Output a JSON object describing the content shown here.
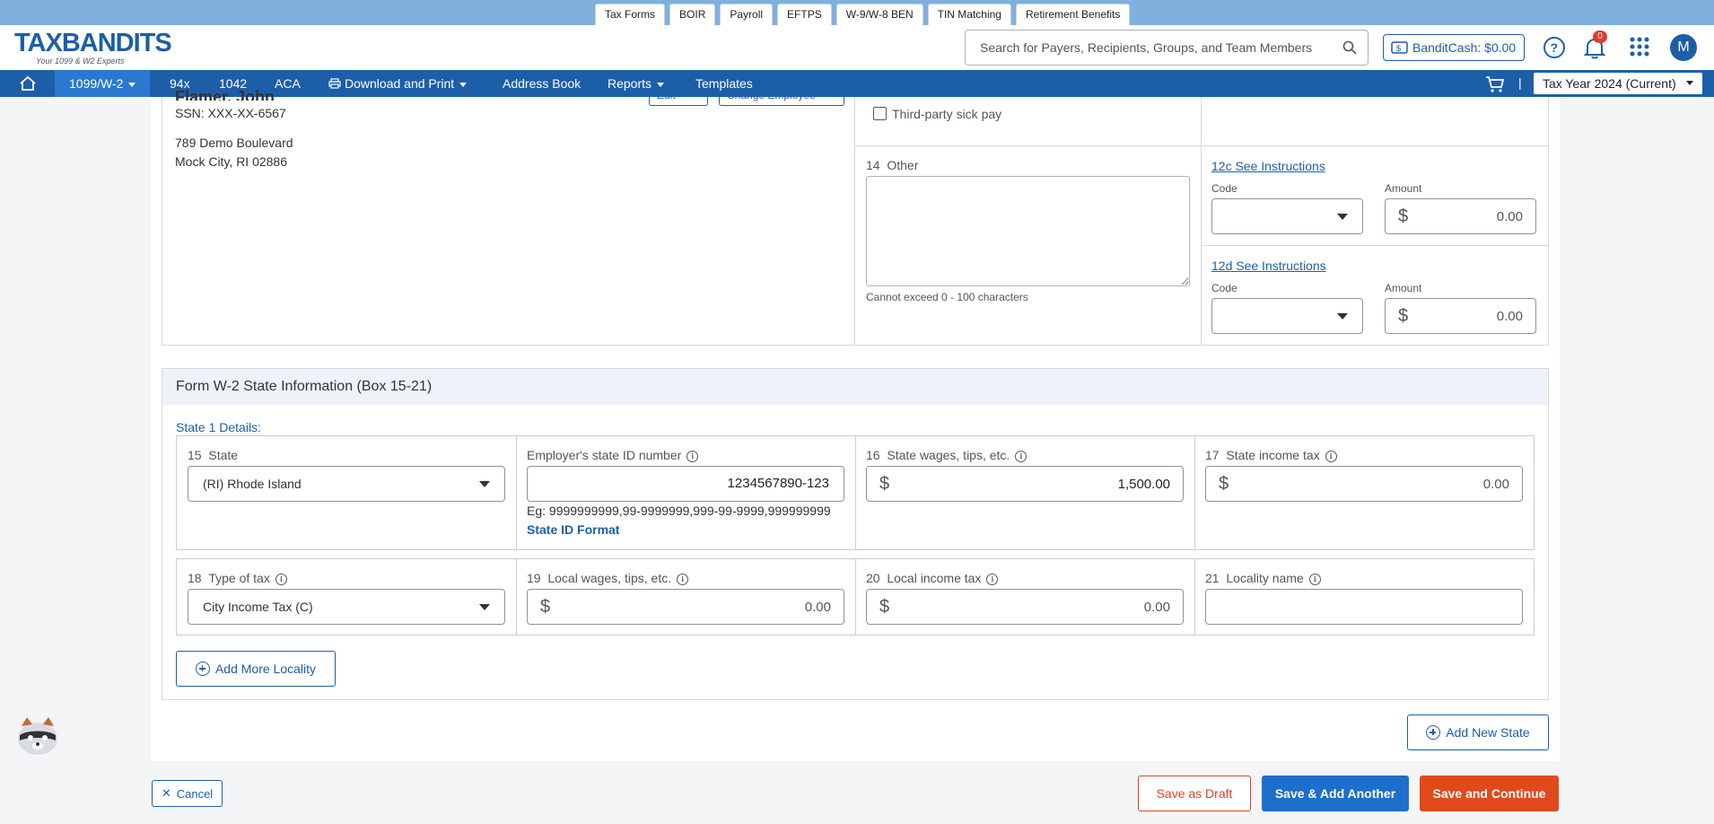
{
  "top_tabs": [
    "Tax Forms",
    "BOIR",
    "Payroll",
    "EFTPS",
    "W-9/W-8 BEN",
    "TIN Matching",
    "Retirement Benefits"
  ],
  "logo": {
    "text": "TAXBANDITS",
    "tagline": "Your 1099 & W2 Experts"
  },
  "search": {
    "placeholder": "Search for Payers, Recipients, Groups, and Team Members"
  },
  "bandit_cash": {
    "label": "BanditCash:",
    "amount": "$0.00"
  },
  "notifications": {
    "count": "0"
  },
  "user": {
    "initial": "M"
  },
  "nav": {
    "items": [
      "1099/W-2",
      "94x",
      "1042",
      "ACA",
      "Download and Print",
      "Address Book",
      "Reports",
      "Templates"
    ],
    "separator": "|",
    "tax_year": "Tax Year 2024 (Current)"
  },
  "employee": {
    "name": "Flamer, John",
    "ssn": "SSN: XXX-XX-6567",
    "address1": "789 Demo Boulevard",
    "address2": "Mock City, RI 02886",
    "edit_label": "Edit",
    "change_label": "Change Employee"
  },
  "box13": {
    "third_party_sick_pay": "Third-party sick pay"
  },
  "box14": {
    "number": "14",
    "label": "Other",
    "hint": "Cannot exceed 0 - 100 characters"
  },
  "box12c": {
    "link": "12c See Instructions",
    "code_label": "Code",
    "amount_label": "Amount",
    "currency": "$",
    "amount": "0.00"
  },
  "box12d": {
    "link": "12d See Instructions",
    "code_label": "Code",
    "amount_label": "Amount",
    "currency": "$",
    "amount": "0.00"
  },
  "state_section": {
    "title": "Form W-2 State Information (Box 15-21)",
    "state1_label": "State 1 Details:",
    "box15": {
      "number": "15",
      "label": "State",
      "value": "(RI) Rhode Island"
    },
    "employer_state_id": {
      "label": "Employer's state ID number",
      "value": "1234567890-123",
      "example": "Eg: 9999999999,99-9999999,999-99-9999,999999999",
      "format_link": "State ID Format"
    },
    "box16": {
      "number": "16",
      "label": "State wages, tips, etc.",
      "currency": "$",
      "value": "1,500.00"
    },
    "box17": {
      "number": "17",
      "label": "State income tax",
      "currency": "$",
      "value": "0.00"
    },
    "box18": {
      "number": "18",
      "label": "Type of tax",
      "value": "City Income Tax (C)"
    },
    "box19": {
      "number": "19",
      "label": "Local wages, tips, etc.",
      "currency": "$",
      "value": "0.00"
    },
    "box20": {
      "number": "20",
      "label": "Local income tax",
      "currency": "$",
      "value": "0.00"
    },
    "box21": {
      "number": "21",
      "label": "Locality name",
      "value": ""
    },
    "add_locality": "Add More Locality",
    "info_glyph": "i"
  },
  "add_state": "Add New State",
  "footer": {
    "cancel": "Cancel",
    "save_draft": "Save as Draft",
    "save_add": "Save & Add Another",
    "save_continue": "Save and Continue"
  },
  "colors": {
    "brand_blue": "#1d5ea8",
    "nav_active": "#2a78d0",
    "orange": "#e04a1a",
    "top_strip": "#7fb0de"
  }
}
